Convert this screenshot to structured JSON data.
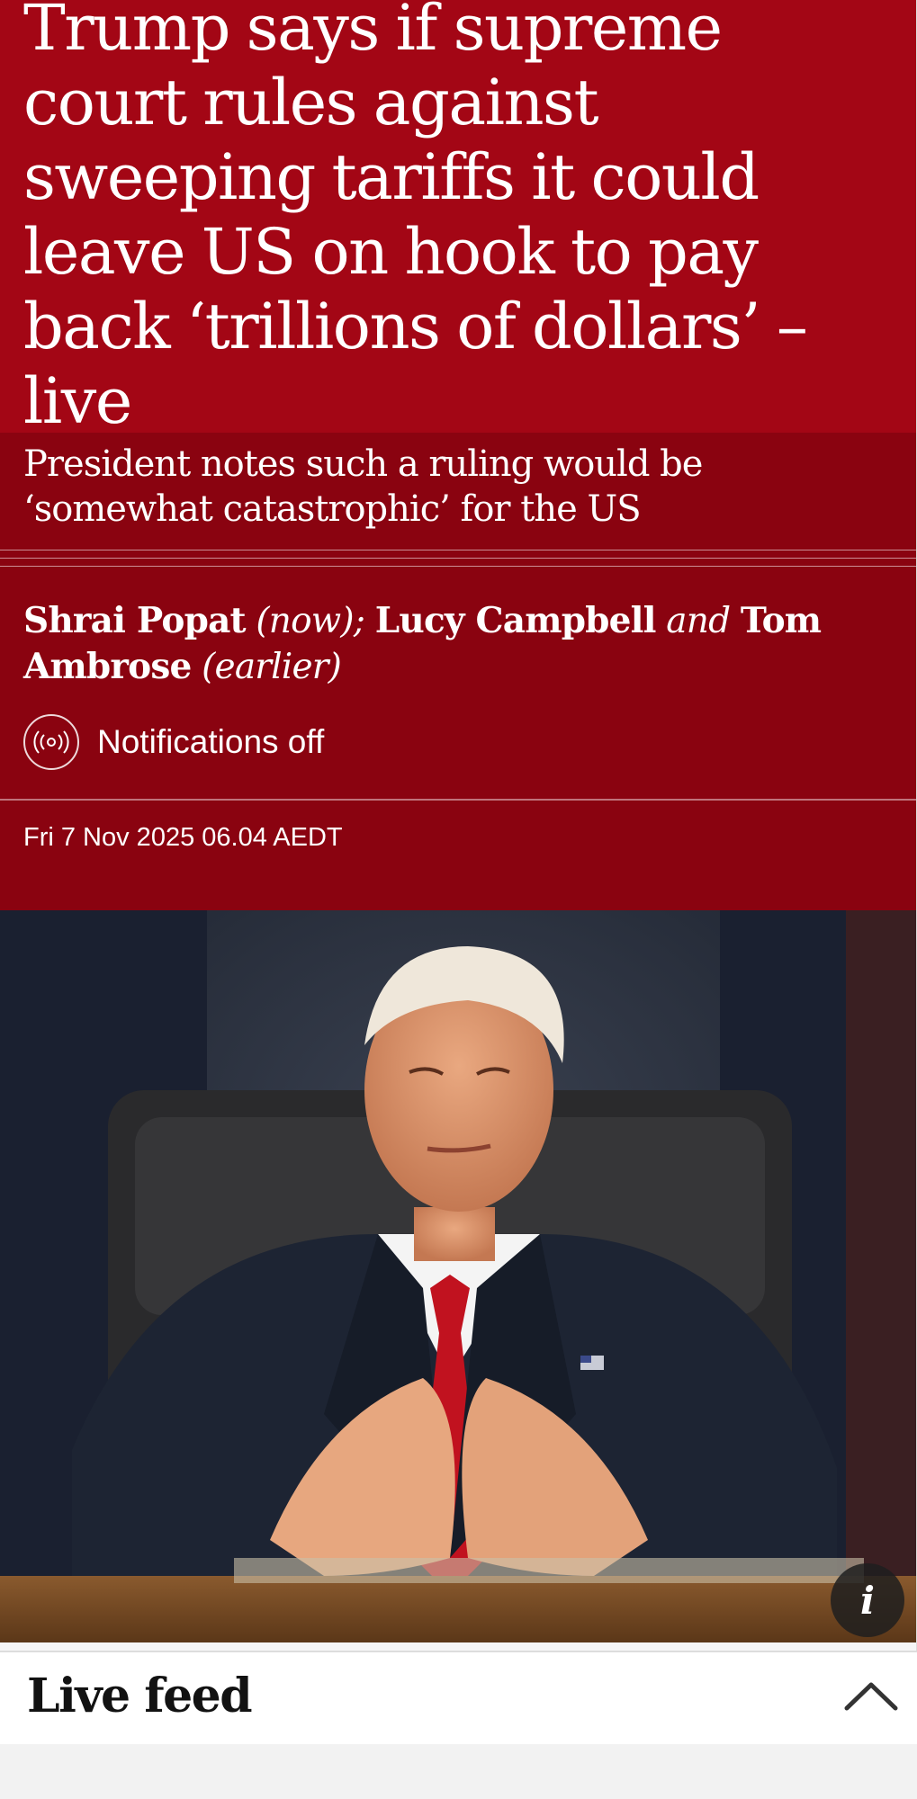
{
  "article": {
    "headline": "Trump says if supreme court rules against sweeping tariffs it could leave US on hook to pay back ‘trillions of dollars’ – live",
    "standfirst": "President notes such a ruling would be ‘somewhat catastrophic’ for the US"
  },
  "byline": {
    "author1": "Shrai Popat",
    "note1": "(now);",
    "author2": "Lucy Campbell",
    "connector": "and",
    "author3": "Tom Ambrose",
    "note2": "(earlier)"
  },
  "notifications": {
    "label": "Notifications off",
    "icon": "broadcast-icon"
  },
  "dateline": "Fri 7 Nov 2025 06.04 AEDT",
  "image": {
    "info_label": "i",
    "info_icon": "info-icon"
  },
  "livefeed": {
    "title": "Live feed",
    "toggle_icon": "chevron-up-icon"
  },
  "colors": {
    "headline_bg": "#a30615",
    "meta_bg": "#8a0310",
    "text": "#ffffff"
  }
}
